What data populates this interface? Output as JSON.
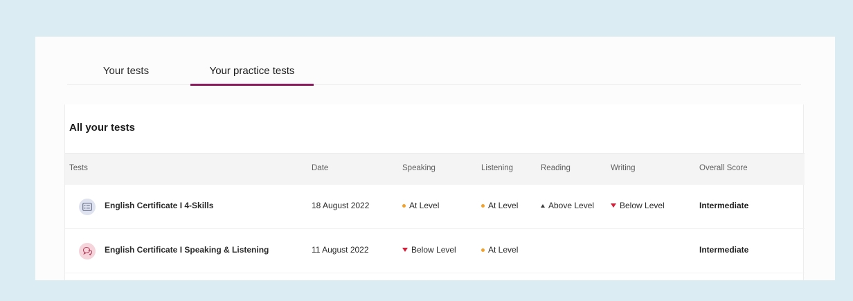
{
  "tabs": [
    {
      "label": "Your tests",
      "active": false
    },
    {
      "label": "Your practice tests",
      "active": true
    }
  ],
  "panel": {
    "title": "All your tests",
    "columns": [
      "Tests",
      "Date",
      "Speaking",
      "Listening",
      "Reading",
      "Writing",
      "Overall Score"
    ],
    "rows": [
      {
        "icon": "document-list-icon",
        "name": "English Certificate I 4-Skills",
        "date": "18 August 2022",
        "speaking": {
          "label": "At Level",
          "indicator": "dot"
        },
        "listening": {
          "label": "At Level",
          "indicator": "dot"
        },
        "reading": {
          "label": "Above Level",
          "indicator": "up"
        },
        "writing": {
          "label": "Below Level",
          "indicator": "down"
        },
        "overall": "Intermediate"
      },
      {
        "icon": "speech-bubbles-icon",
        "name": "English Certificate I Speaking & Listening",
        "date": "11 August 2022",
        "speaking": {
          "label": "Below Level",
          "indicator": "down"
        },
        "listening": {
          "label": "At Level",
          "indicator": "dot"
        },
        "reading": {
          "label": "",
          "indicator": ""
        },
        "writing": {
          "label": "",
          "indicator": ""
        },
        "overall": "Intermediate"
      }
    ]
  },
  "colors": {
    "background": "#dbecf3",
    "accent": "#8b1a5e",
    "at_level": "#f2a22a",
    "below_level": "#d1213a",
    "above_level": "#3a3a3a"
  }
}
